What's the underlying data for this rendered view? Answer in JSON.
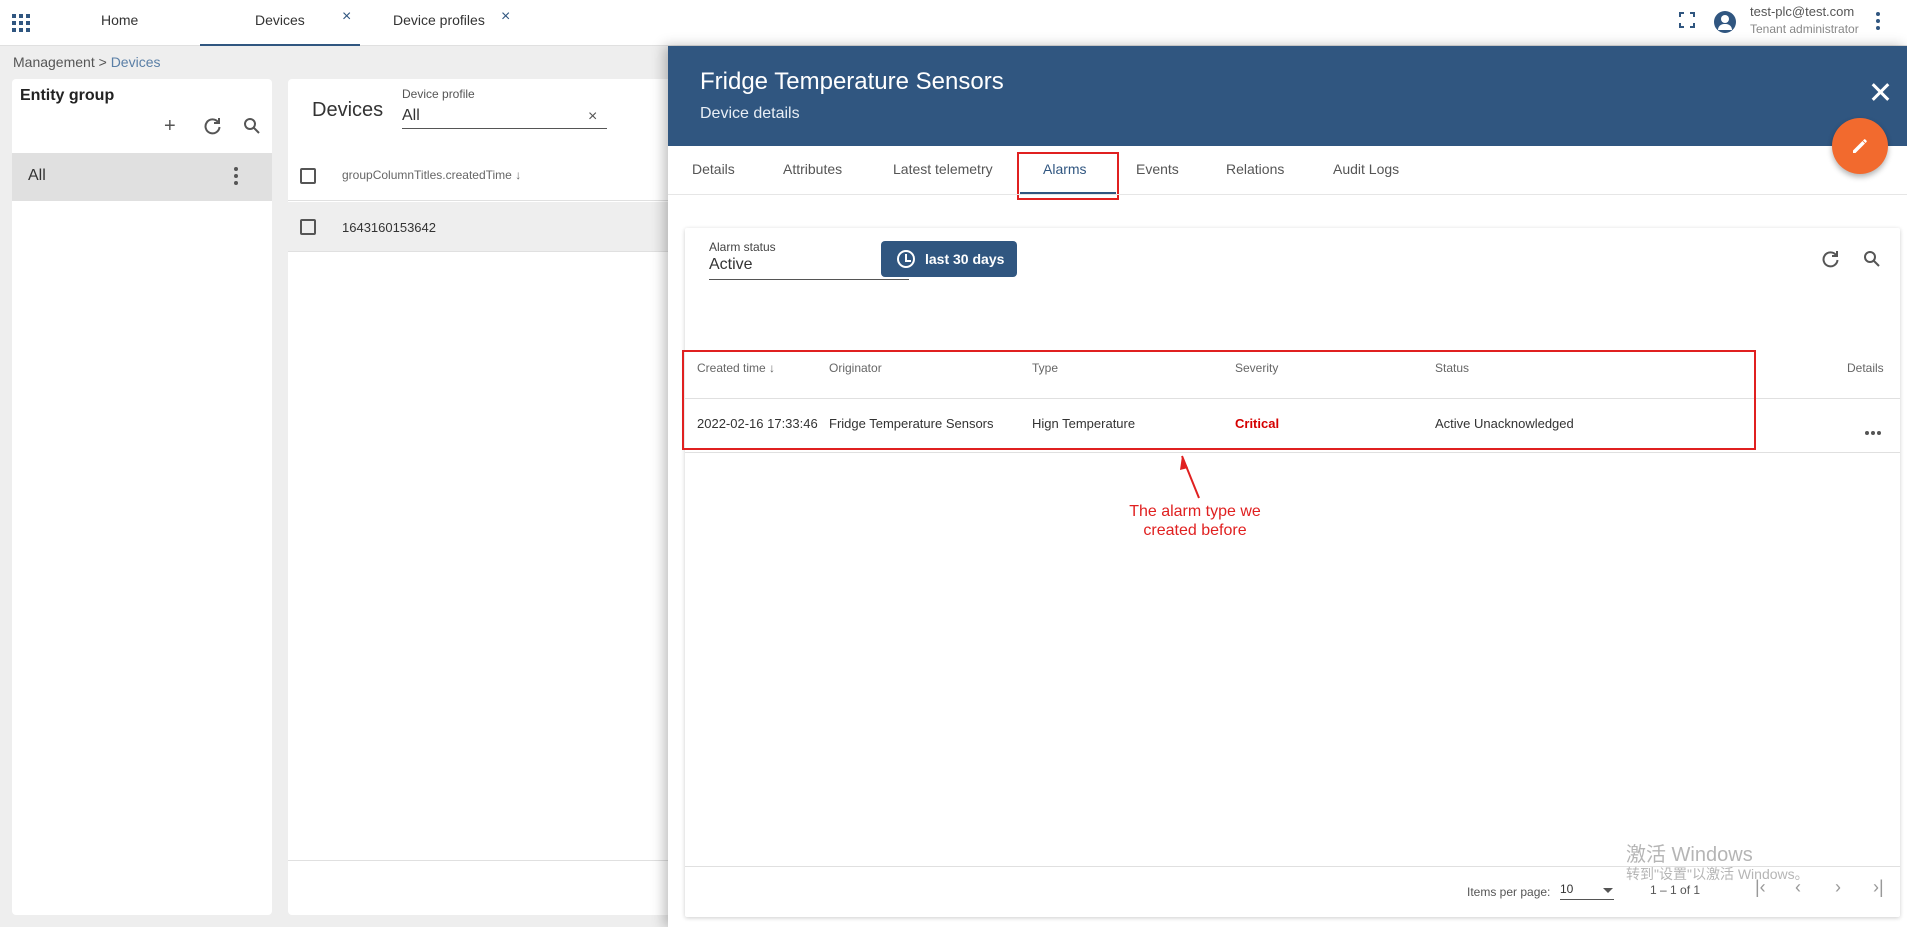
{
  "topbar": {
    "tabs": [
      {
        "label": "Home"
      },
      {
        "label": "Devices"
      },
      {
        "label": "Device profiles"
      }
    ],
    "user_email": "test-plc@test.com",
    "user_role": "Tenant administrator"
  },
  "breadcrumb": {
    "parent": "Management",
    "separator": ">",
    "current": "Devices"
  },
  "entity_group": {
    "title": "Entity group",
    "items": [
      {
        "label": "All"
      }
    ]
  },
  "devices": {
    "title": "Devices",
    "profile_label": "Device profile",
    "profile_value": "All",
    "column": "groupColumnTitles.createdTime",
    "rows": [
      {
        "created_time": "1643160153642"
      }
    ]
  },
  "details": {
    "title": "Fridge Temperature Sensors",
    "subtitle": "Device details",
    "tabs": [
      "Details",
      "Attributes",
      "Latest telemetry",
      "Alarms",
      "Events",
      "Relations",
      "Audit Logs"
    ],
    "active_tab": "Alarms",
    "alarm_status_label": "Alarm status",
    "alarm_status_value": "Active",
    "time_window": "last 30 days",
    "columns": [
      "Created time",
      "Originator",
      "Type",
      "Severity",
      "Status",
      "Details"
    ],
    "rows": [
      {
        "created_time": "2022-02-16 17:33:46",
        "originator": "Fridge Temperature Sensors",
        "type": "Hign Temperature",
        "severity": "Critical",
        "status": "Active Unacknowledged"
      }
    ],
    "annotation": "The alarm type we created before",
    "pager": {
      "items_per_page_label": "Items per page:",
      "items_per_page": "10",
      "range": "1 – 1 of 1"
    }
  },
  "watermark": {
    "line1": "激活 Windows",
    "line2": "转到\"设置\"以激活 Windows。"
  },
  "colors": {
    "primary": "#305680",
    "accent": "#f26a2e",
    "critical": "#d50000",
    "annotation": "#e02020"
  }
}
